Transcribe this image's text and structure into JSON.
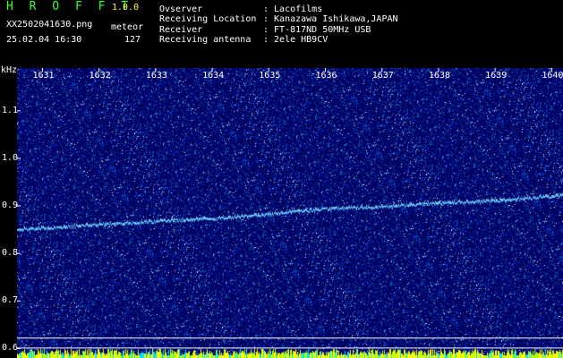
{
  "header": {
    "app_title": "H R O F F T",
    "app_version": "1.0.0",
    "filename": "XX2502041630.png",
    "meteor_label": "meteor",
    "datetime": "25.02.04 16:30",
    "meteor_count": "127",
    "info": [
      {
        "label": "Ovserver",
        "value": ": Lacofilms"
      },
      {
        "label": "Receiving Location",
        "value": ": Kanazawa Ishikawa,JAPAN"
      },
      {
        "label": "Receiver",
        "value": ": FT-817ND 50MHz USB"
      },
      {
        "label": "Receiving antenna",
        "value": ": 2ele HB9CV"
      }
    ]
  },
  "colors": {
    "background": "#000000",
    "plot_noise_base": "#00007a",
    "header_text": "#ffffff",
    "accent_text": "#ffff33",
    "signal": "#66ccff",
    "bottom_band": "#ffff00"
  },
  "chart_data": {
    "type": "heatmap",
    "ylabel": "kHz",
    "y_ticks": [
      "1.1",
      "1.0",
      "0.9",
      "0.8",
      "0.7",
      "0.6"
    ],
    "x_ticks": [
      "1631",
      "1632",
      "1633",
      "1634",
      "1635",
      "1636",
      "1637",
      "1638",
      "1639",
      "1640"
    ],
    "ylim": [
      0.58,
      1.19
    ],
    "xlim": [
      1630.55,
      1640.2
    ],
    "signal_trace": {
      "x": [
        1630.55,
        1631,
        1632,
        1633,
        1634,
        1635,
        1636,
        1637,
        1638,
        1639,
        1640,
        1640.2
      ],
      "y": [
        0.85,
        0.852,
        0.86,
        0.867,
        0.872,
        0.882,
        0.893,
        0.898,
        0.905,
        0.91,
        0.92,
        0.922
      ]
    },
    "reference_lines": [
      0.622,
      0.601
    ]
  }
}
